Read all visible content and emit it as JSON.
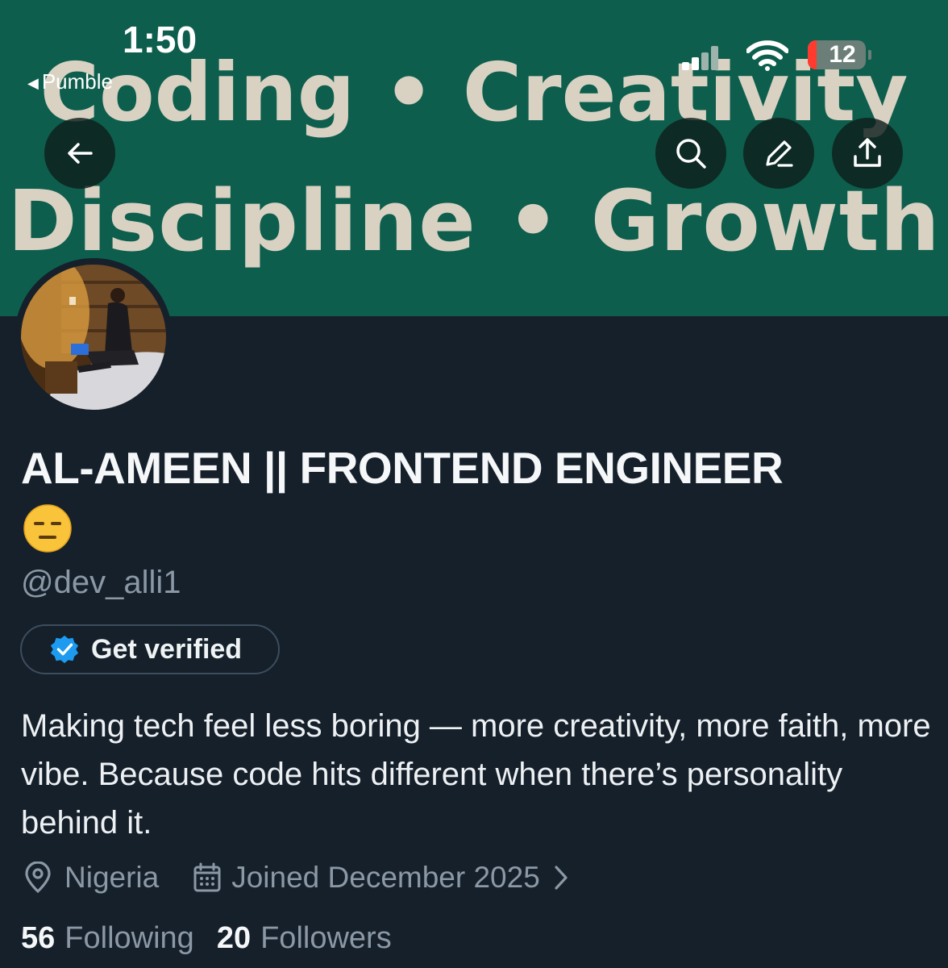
{
  "status_bar": {
    "time": "1:50",
    "back_app": "Pumble",
    "battery_level": "12"
  },
  "banner": {
    "line1": "Coding • Creativity",
    "line2": "Discipline • Growth",
    "background_color": "#0e5e4d"
  },
  "header_actions": {
    "back_icon": "arrow-left-icon",
    "search_icon": "search-icon",
    "edit_icon": "pencil-icon",
    "share_icon": "share-icon"
  },
  "profile": {
    "display_name": "AL-AMEEN || FRONTEND ENGINEER",
    "emoji": "😑",
    "handle": "@dev_alli1",
    "get_verified_label": "Get verified",
    "bio": "Making tech feel less boring — more creativity, more faith, more vibe. Because code hits different when there’s personality behind it.",
    "location": "Nigeria",
    "joined": "Joined December 2025",
    "following_count": "56",
    "following_label": "Following",
    "followers_count": "20",
    "followers_label": "Followers"
  },
  "colors": {
    "page_background": "#15202b",
    "secondary_text": "#8b98a5",
    "verified_blue": "#1d9bf0"
  }
}
